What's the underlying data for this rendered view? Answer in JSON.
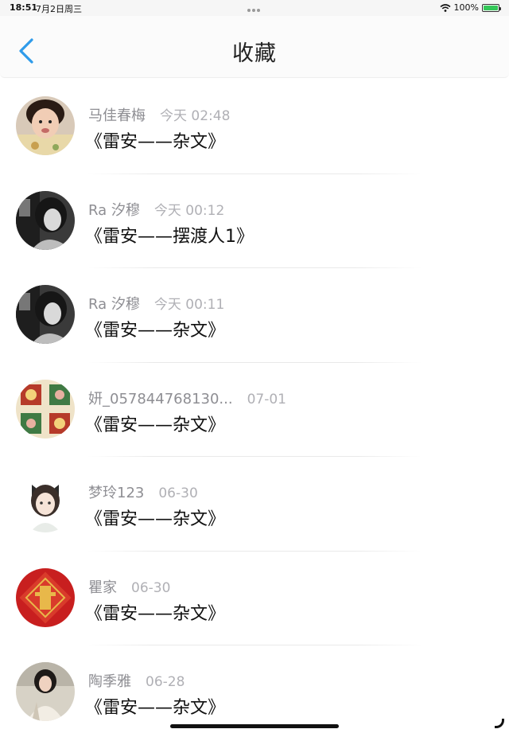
{
  "status_bar": {
    "time": "18:51",
    "date": "7月2日周三",
    "battery_percent": "100%",
    "icons": [
      "wifi-icon",
      "battery-icon",
      "multitask-dots-icon"
    ]
  },
  "header": {
    "title": "收藏",
    "back_icon": "chevron-left-icon",
    "accent_color": "#2f9bea"
  },
  "favorites": [
    {
      "user": "马佳春梅",
      "time": "今天 02:48",
      "title": "《雷安——杂文》",
      "avatar": "child-photo-avatar"
    },
    {
      "user": "Ra 汐穆",
      "time": "今天 00:12",
      "title": "《雷安——摆渡人1》",
      "avatar": "grayscale-girl-avatar"
    },
    {
      "user": "Ra 汐穆",
      "time": "今天 00:11",
      "title": "《雷安——杂文》",
      "avatar": "grayscale-girl-avatar"
    },
    {
      "user": "妍_057844768130...",
      "time": "07-01",
      "title": "《雷安——杂文》",
      "avatar": "new-year-pattern-avatar"
    },
    {
      "user": "梦玲123",
      "time": "06-30",
      "title": "《雷安——杂文》",
      "avatar": "anime-girl-avatar"
    },
    {
      "user": "瞿家",
      "time": "06-30",
      "title": "《雷安——杂文》",
      "avatar": "fu-character-avatar"
    },
    {
      "user": "陶季雅",
      "time": "06-28",
      "title": "《雷安——杂文》",
      "avatar": "woman-photo-avatar"
    }
  ]
}
